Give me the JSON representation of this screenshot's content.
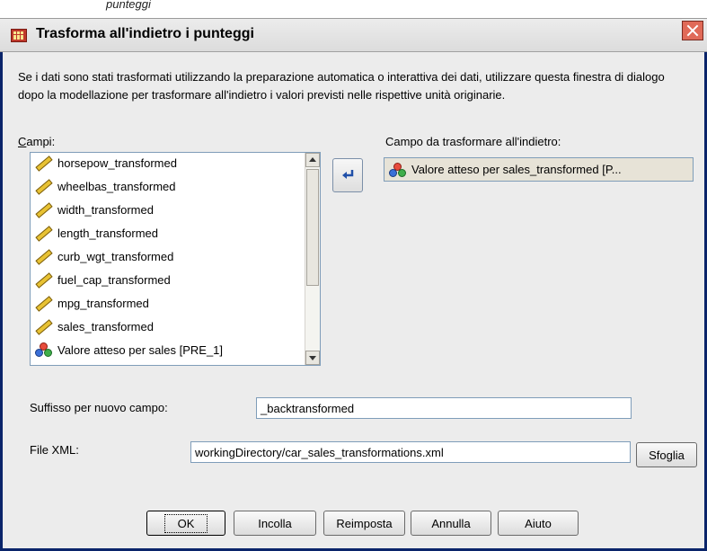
{
  "caption_strip": "punteggi",
  "window": {
    "title": "Trasforma all'indietro i punteggi"
  },
  "description": "Se i dati sono stati trasformati utilizzando la preparazione automatica o interattiva dei dati, utilizzare questa finestra di dialogo dopo la modellazione per trasformare all'indietro i valori previsti nelle rispettive unità originarie.",
  "fields": {
    "label": "Campi:",
    "items": [
      {
        "label": "horsepow_transformed",
        "icon": "ruler-icon"
      },
      {
        "label": "wheelbas_transformed",
        "icon": "ruler-icon"
      },
      {
        "label": "width_transformed",
        "icon": "ruler-icon"
      },
      {
        "label": "length_transformed",
        "icon": "ruler-icon"
      },
      {
        "label": "curb_wgt_transformed",
        "icon": "ruler-icon"
      },
      {
        "label": "fuel_cap_transformed",
        "icon": "ruler-icon"
      },
      {
        "label": "mpg_transformed",
        "icon": "ruler-icon"
      },
      {
        "label": "sales_transformed",
        "icon": "ruler-icon"
      },
      {
        "label": "Valore atteso per sales [PRE_1]",
        "icon": "nominal-icon"
      }
    ]
  },
  "target": {
    "label": "Campo da trasformare all'indietro:",
    "value": "Valore atteso per sales_transformed [P..."
  },
  "suffix": {
    "label": "Suffisso per nuovo campo:",
    "value": "_backtransformed"
  },
  "xml": {
    "label": "File XML:",
    "value": "workingDirectory/car_sales_transformations.xml",
    "browse": "Sfoglia"
  },
  "buttons": {
    "ok": "OK",
    "paste": "Incolla",
    "reset": "Reimposta",
    "cancel": "Annulla",
    "help": "Aiuto"
  }
}
